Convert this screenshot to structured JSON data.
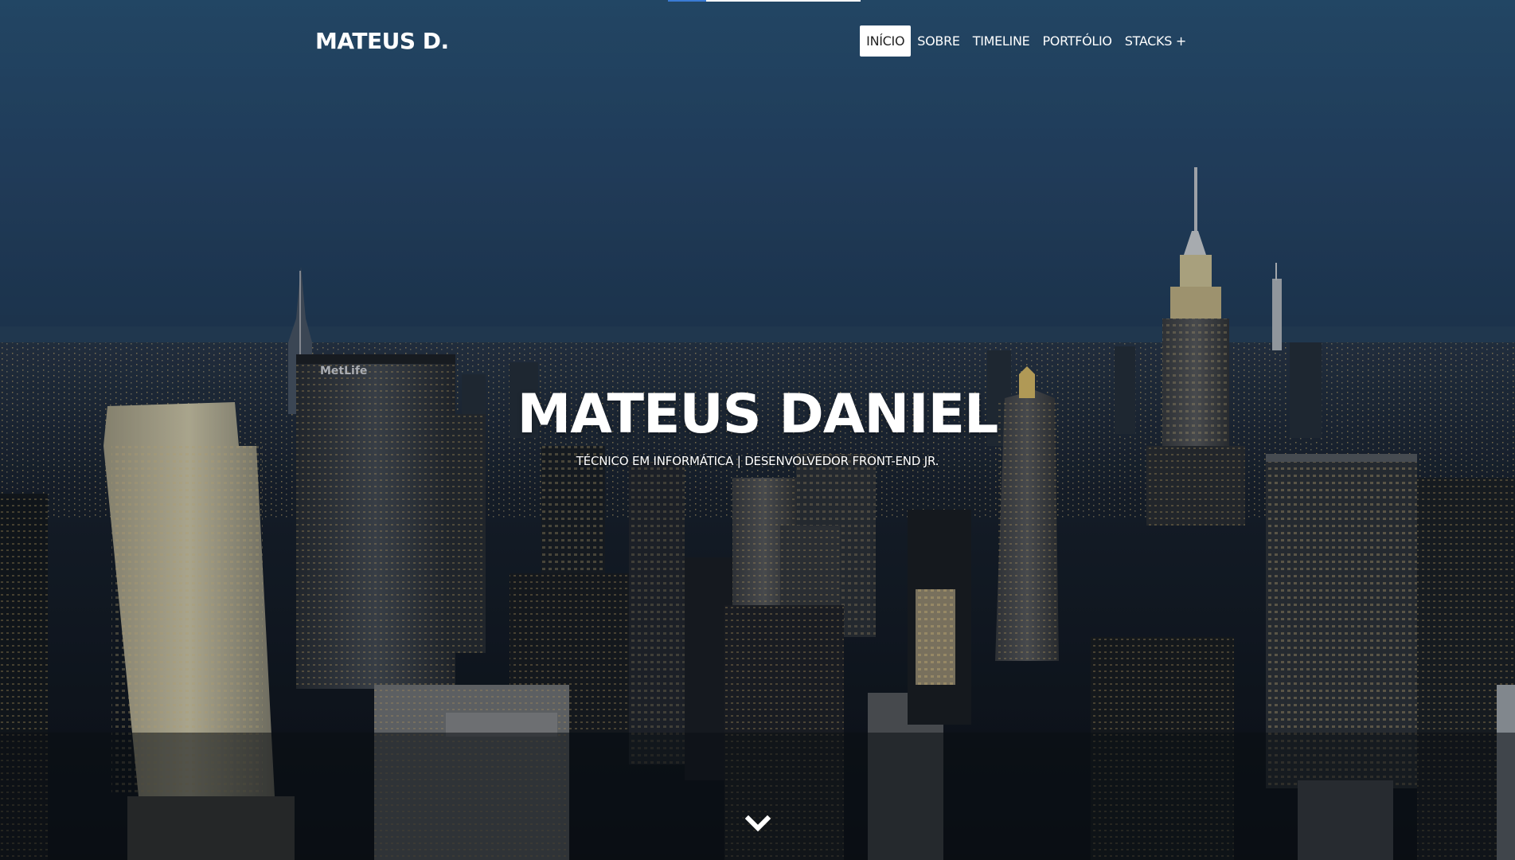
{
  "header": {
    "brand": "MATEUS D.",
    "nav_items": [
      {
        "label": "INÍCIO",
        "active": true
      },
      {
        "label": "SOBRE",
        "active": false
      },
      {
        "label": "TIMELINE",
        "active": false
      },
      {
        "label": "PORTFÓLIO",
        "active": false
      },
      {
        "label": "STACKS +",
        "active": false
      }
    ]
  },
  "hero": {
    "title": "MATEUS DANIEL",
    "subtitle": "TÉCNICO EM INFORMÁTICA | DESENVOLVEDOR FRONT-END JR.",
    "background": "night-city-skyline-photo",
    "scroll_icon": "chevron-down-icon"
  },
  "progress": {
    "value": 0.2,
    "fill_color": "#3a7bd5",
    "track_color": "#ffffff"
  },
  "colors": {
    "sky_top": "#2a5278",
    "sky_horizon": "#2d4a6a",
    "city_dark": "#101820",
    "text": "#ffffff",
    "active_nav_bg": "#ffffff",
    "active_nav_text": "#222222"
  }
}
